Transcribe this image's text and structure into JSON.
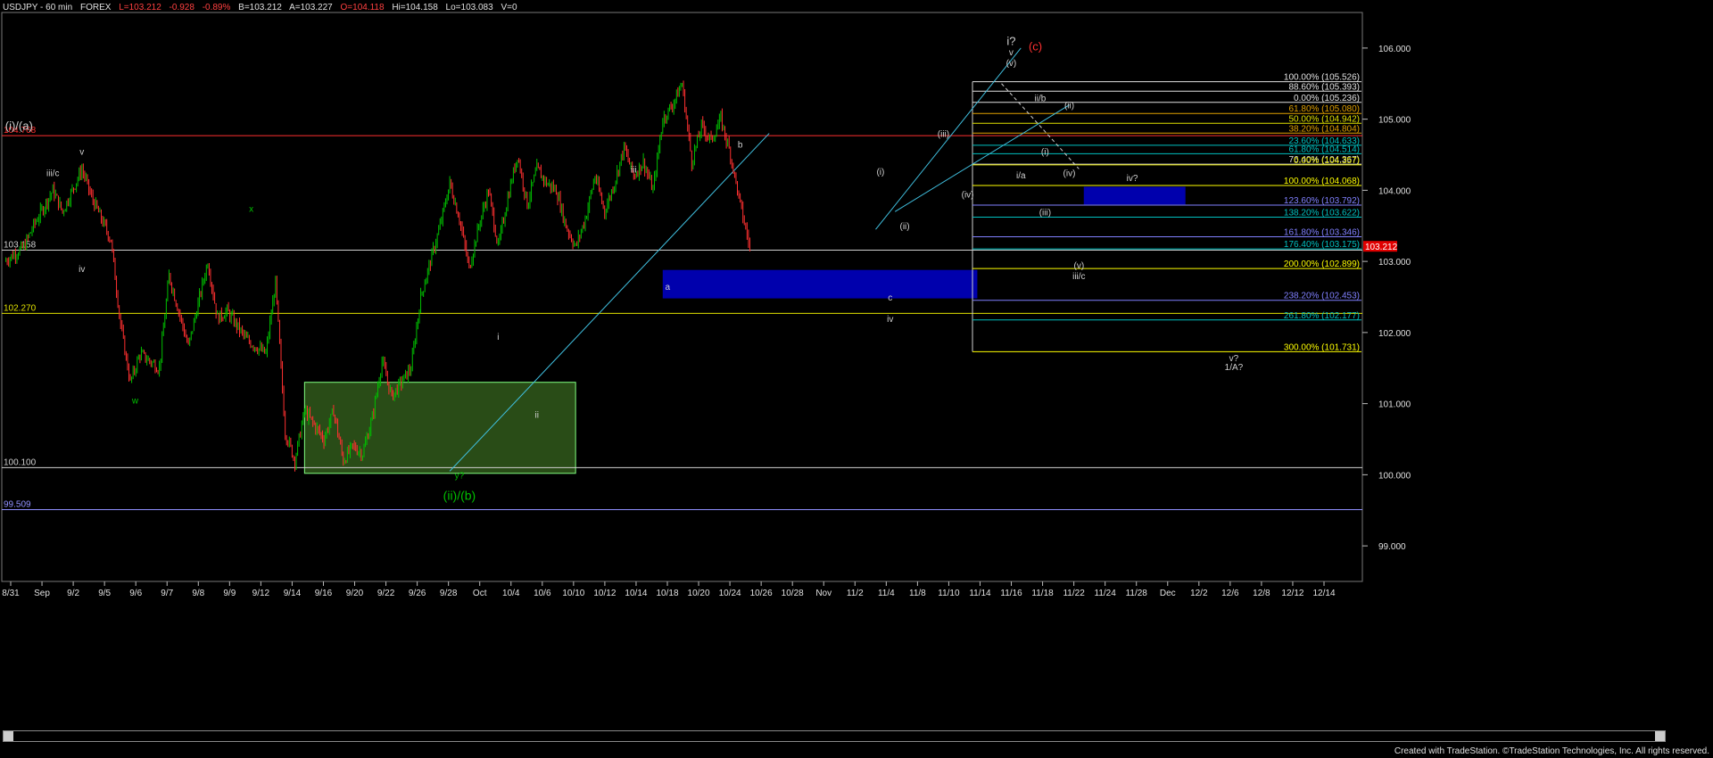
{
  "header": {
    "symbol": "USDJPY - 60 min",
    "market": "FOREX",
    "last": "L=103.212",
    "change": "-0.928",
    "change_pct": "-0.89%",
    "bid": "B=103.212",
    "ask": "A=103.227",
    "open": "O=104.118",
    "high": "Hi=104.158",
    "low": "Lo=103.083",
    "volume": "V=0"
  },
  "footer": {
    "credit": "Created with TradeStation. ©TradeStation Technologies, Inc. All rights reserved."
  },
  "colors": {
    "bg": "#000000",
    "up": "#00c000",
    "down": "#ff3030",
    "grid": "#2a2a2a",
    "axis": "#bdbdbd"
  },
  "chart_data": {
    "type": "candlestick",
    "title": "USDJPY - 60 min",
    "ylim": [
      98.5,
      106.5
    ],
    "y_ticks": [
      "99.000",
      "100.000",
      "101.000",
      "102.000",
      "103.000",
      "104.000",
      "105.000",
      "106.000"
    ],
    "y_tick_values": [
      99,
      100,
      101,
      102,
      103,
      104,
      105,
      106
    ],
    "x_ticks": [
      "8/31",
      "Sep",
      "9/2",
      "9/5",
      "9/6",
      "9/7",
      "9/8",
      "9/9",
      "9/12",
      "9/14",
      "9/16",
      "9/20",
      "9/22",
      "9/26",
      "9/28",
      "Oct",
      "10/4",
      "10/6",
      "10/10",
      "10/12",
      "10/14",
      "10/18",
      "10/20",
      "10/24",
      "10/26",
      "10/28",
      "Nov",
      "11/2",
      "11/4",
      "11/8",
      "11/10",
      "11/14",
      "11/16",
      "11/18",
      "11/22",
      "11/24",
      "11/28",
      "Dec",
      "12/2",
      "12/6",
      "12/8",
      "12/12",
      "12/14"
    ],
    "last_price": "103.212",
    "price_path": [
      [
        0,
        103.0
      ],
      [
        2,
        103.2
      ],
      [
        3,
        103.5
      ],
      [
        5,
        104.0
      ],
      [
        6,
        103.7
      ],
      [
        8,
        104.3
      ],
      [
        9,
        103.9
      ],
      [
        11,
        103.3
      ],
      [
        12,
        102.1
      ],
      [
        13,
        101.3
      ],
      [
        14,
        101.7
      ],
      [
        16,
        101.5
      ],
      [
        17,
        102.8
      ],
      [
        18,
        102.3
      ],
      [
        19,
        101.8
      ],
      [
        21,
        103.0
      ],
      [
        22,
        102.2
      ],
      [
        23,
        102.3
      ],
      [
        25,
        101.9
      ],
      [
        27,
        101.7
      ],
      [
        28,
        102.7
      ],
      [
        29,
        100.6
      ],
      [
        30,
        100.2
      ],
      [
        31,
        100.9
      ],
      [
        33,
        100.5
      ],
      [
        34,
        100.9
      ],
      [
        35,
        100.2
      ],
      [
        36,
        100.4
      ],
      [
        37,
        100.3
      ],
      [
        38,
        100.8
      ],
      [
        39,
        101.6
      ],
      [
        40,
        101.1
      ],
      [
        41,
        101.3
      ],
      [
        42,
        101.5
      ],
      [
        43,
        102.5
      ],
      [
        44,
        103.0
      ],
      [
        45,
        103.5
      ],
      [
        46,
        104.1
      ],
      [
        47,
        103.6
      ],
      [
        48,
        102.9
      ],
      [
        49,
        103.5
      ],
      [
        50,
        104.0
      ],
      [
        51,
        103.2
      ],
      [
        52,
        103.9
      ],
      [
        53,
        104.5
      ],
      [
        54,
        103.8
      ],
      [
        55,
        104.3
      ],
      [
        56,
        104.1
      ],
      [
        57,
        104.0
      ],
      [
        58,
        103.5
      ],
      [
        59,
        103.2
      ],
      [
        60,
        103.6
      ],
      [
        61,
        104.2
      ],
      [
        62,
        103.7
      ],
      [
        63,
        104.1
      ],
      [
        64,
        104.6
      ],
      [
        65,
        104.2
      ],
      [
        66,
        104.4
      ],
      [
        67,
        104.0
      ],
      [
        68,
        105.0
      ],
      [
        69,
        105.2
      ],
      [
        70,
        105.5
      ],
      [
        71,
        104.4
      ],
      [
        72,
        104.9
      ],
      [
        73,
        104.7
      ],
      [
        74,
        105.0
      ],
      [
        75,
        104.5
      ],
      [
        76,
        103.8
      ],
      [
        77,
        103.2
      ]
    ],
    "horizontal_levels": [
      {
        "price": 104.768,
        "label": "104.768",
        "color": "#ff3030",
        "side": "left"
      },
      {
        "price": 103.158,
        "label": "103.158",
        "color": "#d0d0d0",
        "side": "left"
      },
      {
        "price": 102.27,
        "label": "102.270",
        "color": "#e0e000",
        "side": "left"
      },
      {
        "price": 100.1,
        "label": "100.100",
        "color": "#d0d0d0",
        "side": "left"
      },
      {
        "price": 99.509,
        "label": "99.509",
        "color": "#9090ff",
        "side": "left"
      }
    ],
    "fib_levels": [
      {
        "price": 105.526,
        "label": "100.00% (105.526)",
        "color": "#e0e0e0"
      },
      {
        "price": 105.393,
        "label": "88.60% (105.393)",
        "color": "#e0e0e0"
      },
      {
        "price": 105.236,
        "label": "0.00% (105.236)",
        "color": "#e0e0e0"
      },
      {
        "price": 105.08,
        "label": "61.80% (105.080)",
        "color": "#e0a000"
      },
      {
        "price": 104.942,
        "label": "50.00% (104.942)",
        "color": "#e0e000"
      },
      {
        "price": 104.804,
        "label": "38.20% (104.804)",
        "color": "#e0a000"
      },
      {
        "price": 104.633,
        "label": "23.60% (104.633)",
        "color": "#00c0c0"
      },
      {
        "price": 104.514,
        "label": "61.80% (104.514)",
        "color": "#00c0c0"
      },
      {
        "price": 104.367,
        "label": "76.40% (104.367)",
        "color": "#e0e0e0"
      },
      {
        "price": 104.357,
        "label": "0.00% (104.357)",
        "color": "#e0e000"
      },
      {
        "price": 104.068,
        "label": "100.00% (104.068)",
        "color": "#ffff00"
      },
      {
        "price": 103.792,
        "label": "123.60% (103.792)",
        "color": "#8080ff"
      },
      {
        "price": 103.622,
        "label": "138.20% (103.622)",
        "color": "#00c0c0"
      },
      {
        "price": 103.346,
        "label": "161.80% (103.346)",
        "color": "#8080ff"
      },
      {
        "price": 103.175,
        "label": "176.40% (103.175)",
        "color": "#00c0c0"
      },
      {
        "price": 102.899,
        "label": "200.00% (102.899)",
        "color": "#ffff00"
      },
      {
        "price": 102.453,
        "label": "238.20% (102.453)",
        "color": "#8080ff"
      },
      {
        "price": 102.177,
        "label": "261.80% (102.177)",
        "color": "#00c0c0"
      },
      {
        "price": 101.731,
        "label": "300.00% (101.731)",
        "color": "#ffff00"
      }
    ],
    "wave_labels": [
      {
        "text": "(i)/(a)",
        "slot": 1.5,
        "price": 104.85,
        "color": "#d0d0d0",
        "size": 13
      },
      {
        "text": "v",
        "slot": 8,
        "price": 104.5,
        "color": "#d0d0d0",
        "size": 10
      },
      {
        "text": "iii/c",
        "slot": 5,
        "price": 104.2,
        "color": "#d0d0d0",
        "size": 10
      },
      {
        "text": "iv",
        "slot": 8,
        "price": 102.85,
        "color": "#d0d0d0",
        "size": 10
      },
      {
        "text": "w",
        "slot": 13.5,
        "price": 101.0,
        "color": "#00c000",
        "size": 10
      },
      {
        "text": "x",
        "slot": 25.5,
        "price": 103.7,
        "color": "#00c000",
        "size": 10
      },
      {
        "text": "y?",
        "slot": 47,
        "price": 99.95,
        "color": "#00c000",
        "size": 10
      },
      {
        "text": "(ii)/(b)",
        "slot": 47,
        "price": 99.65,
        "color": "#00c000",
        "size": 14
      },
      {
        "text": "i",
        "slot": 51,
        "price": 101.9,
        "color": "#d0d0d0",
        "size": 10
      },
      {
        "text": "ii",
        "slot": 55,
        "price": 100.8,
        "color": "#d0d0d0",
        "size": 10
      },
      {
        "text": "iii",
        "slot": 65,
        "price": 104.25,
        "color": "#d0d0d0",
        "size": 10
      },
      {
        "text": "a",
        "slot": 68.5,
        "price": 102.6,
        "color": "#d0d0d0",
        "size": 10
      },
      {
        "text": "b",
        "slot": 76,
        "price": 104.6,
        "color": "#d0d0d0",
        "size": 10
      },
      {
        "text": "c",
        "slot": 91.5,
        "price": 102.45,
        "color": "#d0d0d0",
        "size": 10
      },
      {
        "text": "iv",
        "slot": 91.5,
        "price": 102.15,
        "color": "#d0d0d0",
        "size": 10
      },
      {
        "text": "(i)",
        "slot": 90.5,
        "price": 104.22,
        "color": "#d0d0d0",
        "size": 10
      },
      {
        "text": "(ii)",
        "slot": 93,
        "price": 103.45,
        "color": "#d0d0d0",
        "size": 10
      },
      {
        "text": "(iii)",
        "slot": 97,
        "price": 104.75,
        "color": "#d0d0d0",
        "size": 10
      },
      {
        "text": "(iv)",
        "slot": 99.5,
        "price": 103.9,
        "color": "#d0d0d0",
        "size": 10
      },
      {
        "text": "(v)",
        "slot": 104,
        "price": 105.75,
        "color": "#d0d0d0",
        "size": 10
      },
      {
        "text": "v",
        "slot": 104,
        "price": 105.9,
        "color": "#d0d0d0",
        "size": 10
      },
      {
        "text": "i?",
        "slot": 104,
        "price": 106.04,
        "color": "#d0d0d0",
        "size": 13
      },
      {
        "text": "(c)",
        "slot": 106.5,
        "price": 105.97,
        "color": "#ff3030",
        "size": 13
      },
      {
        "text": "ii/b",
        "slot": 107,
        "price": 105.25,
        "color": "#d0d0d0",
        "size": 10
      },
      {
        "text": "(ii)",
        "slot": 110,
        "price": 105.15,
        "color": "#d0d0d0",
        "size": 10
      },
      {
        "text": "(i)",
        "slot": 107.5,
        "price": 104.5,
        "color": "#d0d0d0",
        "size": 10
      },
      {
        "text": "i/a",
        "slot": 105,
        "price": 104.17,
        "color": "#d0d0d0",
        "size": 10
      },
      {
        "text": "(iv)",
        "slot": 110,
        "price": 104.2,
        "color": "#d0d0d0",
        "size": 10
      },
      {
        "text": "(iii)",
        "slot": 107.5,
        "price": 103.65,
        "color": "#d0d0d0",
        "size": 10
      },
      {
        "text": "iv?",
        "slot": 116.5,
        "price": 104.13,
        "color": "#d0d0d0",
        "size": 10
      },
      {
        "text": "(v)",
        "slot": 111,
        "price": 102.9,
        "color": "#d0d0d0",
        "size": 10
      },
      {
        "text": "iii/c",
        "slot": 111,
        "price": 102.75,
        "color": "#d0d0d0",
        "size": 10
      },
      {
        "text": "v?",
        "slot": 127,
        "price": 101.6,
        "color": "#d0d0d0",
        "size": 10
      },
      {
        "text": "1/A?",
        "slot": 127,
        "price": 101.47,
        "color": "#d0d0d0",
        "size": 10
      }
    ]
  }
}
